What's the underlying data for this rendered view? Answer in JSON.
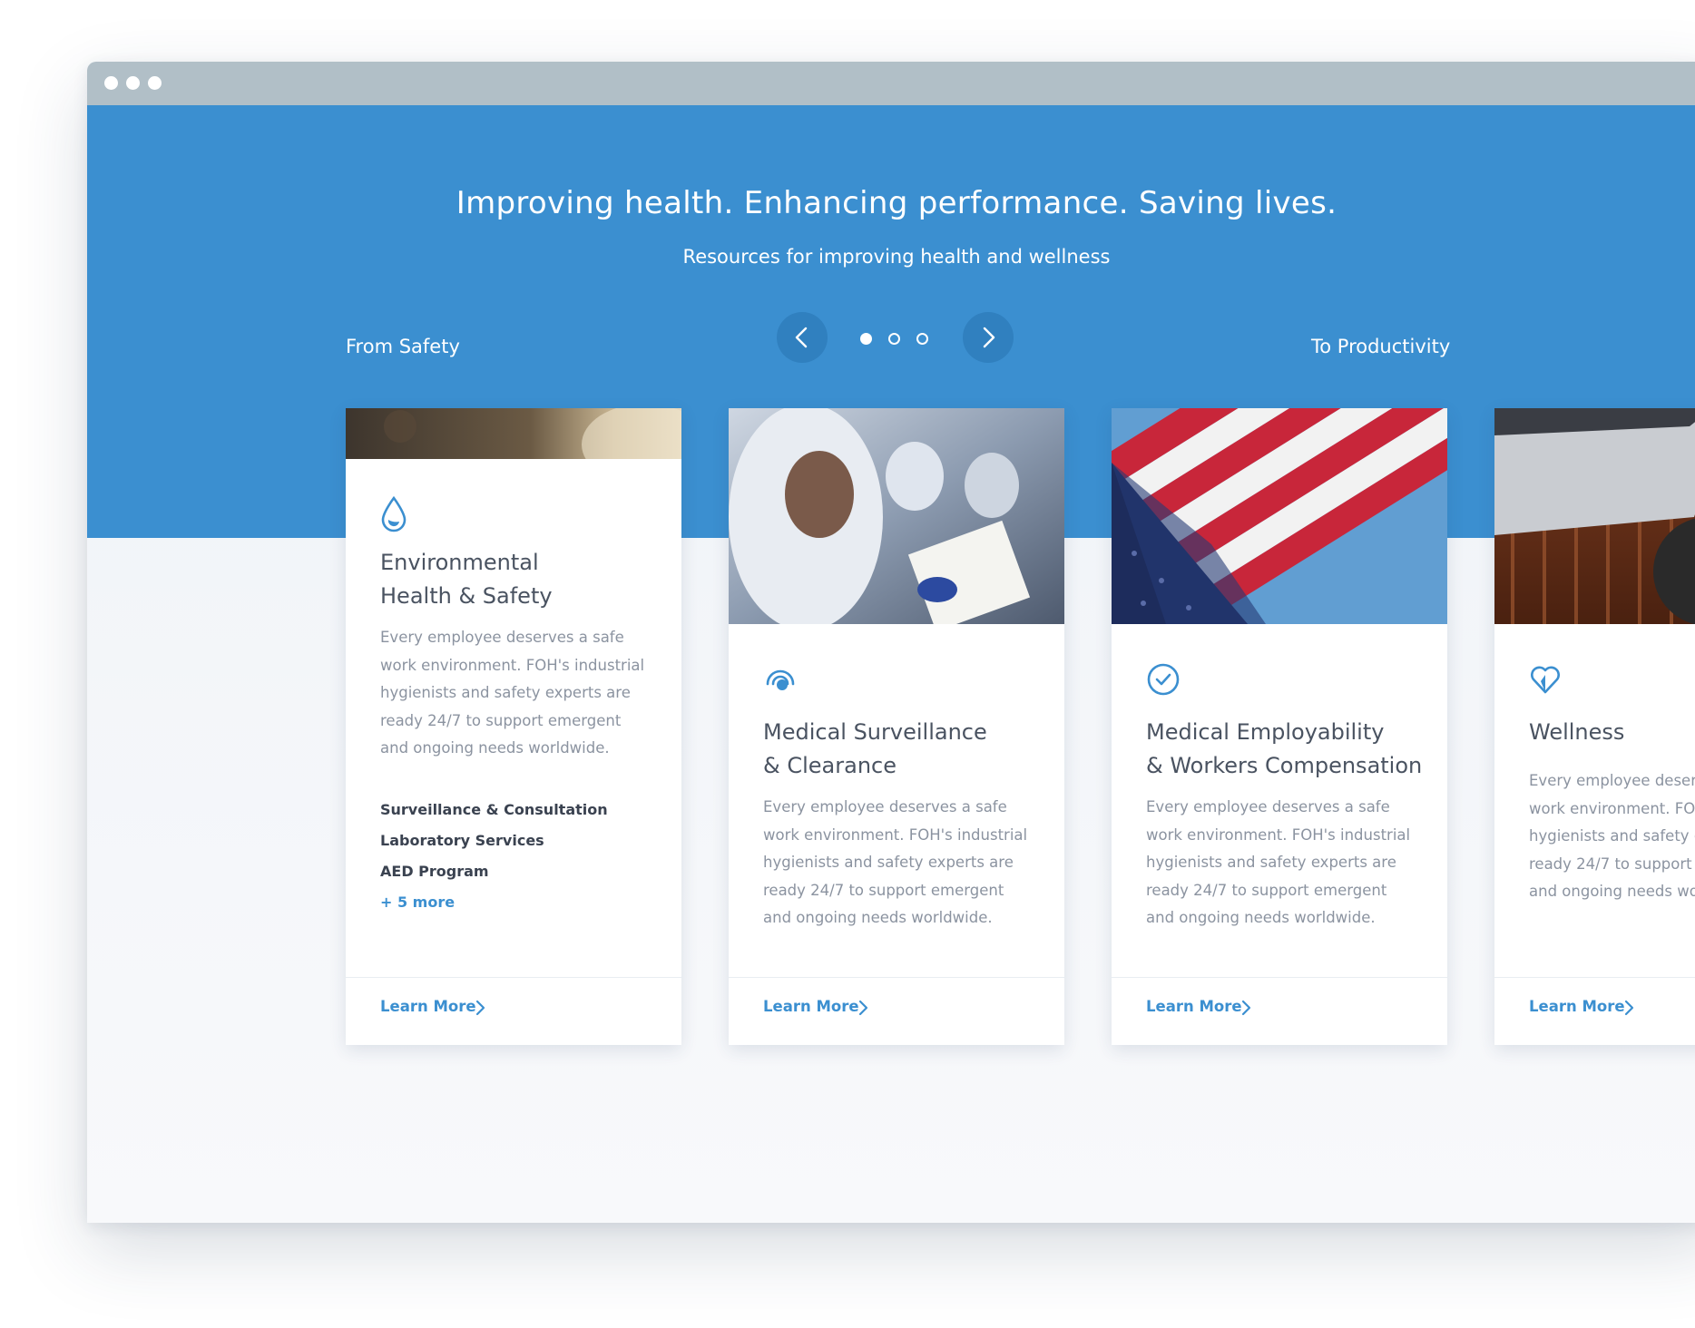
{
  "hero": {
    "headline": "Improving health. Enhancing performance. Saving lives.",
    "subheadline": "Resources for improving health and wellness",
    "left_label": "From Safety",
    "right_label": "To Productivity",
    "pager": {
      "current": 1,
      "total": 3
    }
  },
  "cards": [
    {
      "icon": "water-drop-icon",
      "title_line1": "Environmental",
      "title_line2": "Health & Safety",
      "description": "Every employee deserves a safe work environment. FOH's industrial hygienists and safety experts are ready 24/7 to support emergent and ongoing needs worldwide.",
      "links": [
        "Surveillance & Consultation",
        "Laboratory Services",
        "AED Program"
      ],
      "more": "+ 5 more",
      "cta": "Learn More"
    },
    {
      "icon": "radar-target-icon",
      "title_line1": "Medical Surveillance",
      "title_line2": "& Clearance",
      "description": "Every employee deserves a safe work environment. FOH's industrial hygienists and safety experts are ready 24/7 to support emergent and ongoing needs worldwide.",
      "cta": "Learn More"
    },
    {
      "icon": "check-circle-icon",
      "title_line1": "Medical Employability",
      "title_line2": "& Workers Compensation",
      "description": "Every employee deserves a safe work environment. FOH's industrial hygienists and safety experts are ready 24/7 to support emergent and ongoing needs worldwide.",
      "cta": "Learn More"
    },
    {
      "icon": "heart-icon",
      "title_line1": "Wellness",
      "description": "Every employee deserves a safe work environment. FOH's industrial hygienists and safety experts are ready 24/7 to support emergent and ongoing needs worldwide.",
      "cta": "Learn More"
    }
  ],
  "colors": {
    "brand_blue": "#3b8fd0",
    "titlebar": "#b1bfc7",
    "heading_text": "#4a5361",
    "body_text": "#8b93a0"
  }
}
